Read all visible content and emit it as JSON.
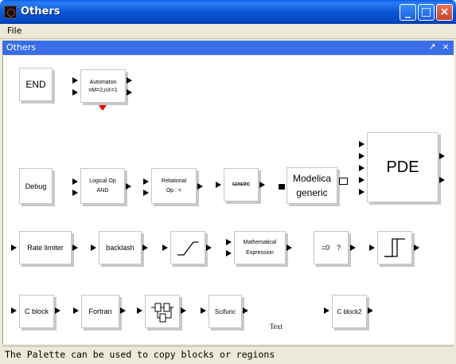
{
  "window": {
    "title": "Others"
  },
  "menu": {
    "file": "File"
  },
  "palette": {
    "title": "Others"
  },
  "status": {
    "text": "The Palette can be used to copy blocks or regions"
  },
  "blocks": {
    "end": "END",
    "automaton": [
      "Automaton",
      "nM=2,nX=1"
    ],
    "debug": "Debug",
    "logical_op": [
      "Logical Op",
      "AND"
    ],
    "relational_op": [
      "Relational",
      "Op : <"
    ],
    "generic": "GENERIC",
    "modelica_generic": [
      "Modelica",
      "generic"
    ],
    "pde": "PDE",
    "rate_limiter": "Rate limiter",
    "backlash": "backlash",
    "math_expression": [
      "Mathematical",
      "Expression"
    ],
    "constraint": [
      "=0",
      "?"
    ],
    "c_block": "C block",
    "fortran": "Fortran",
    "scifunc": "Scifunc",
    "text": "Text",
    "c_block2": "C block2"
  },
  "icons": [
    "window-app-icon",
    "minimize-icon",
    "maximize-icon",
    "close-icon",
    "undock-icon",
    "palette-close-icon",
    "ramp-icon",
    "hysteresis-icon",
    "super-block-icon"
  ]
}
